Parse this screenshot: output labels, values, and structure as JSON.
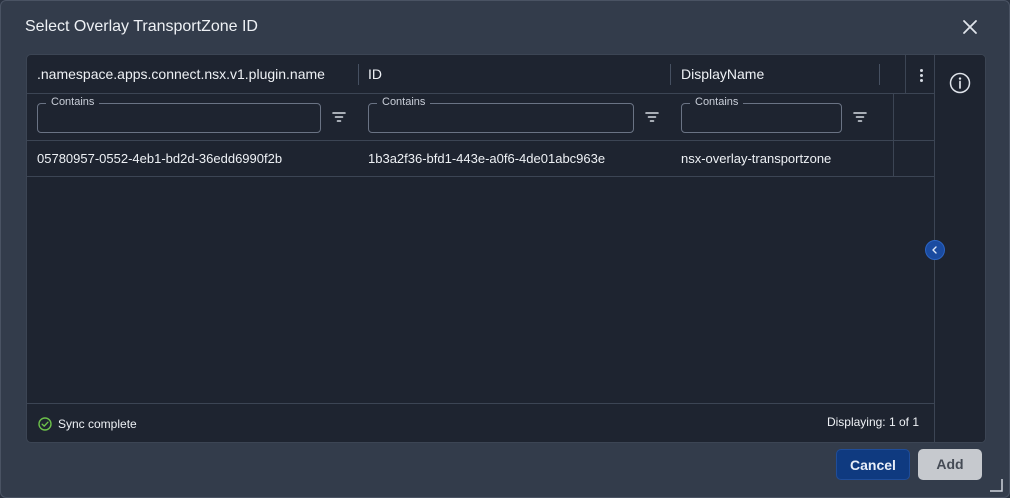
{
  "dialog": {
    "title": "Select Overlay TransportZone ID"
  },
  "grid": {
    "columns": [
      {
        "label": ".namespace.apps.connect.nsx.v1.plugin.name"
      },
      {
        "label": "ID"
      },
      {
        "label": "DisplayName"
      }
    ],
    "filters": [
      {
        "legend": "Contains",
        "value": ""
      },
      {
        "legend": "Contains",
        "value": ""
      },
      {
        "legend": "Contains",
        "value": ""
      }
    ],
    "rows": [
      {
        "name": "05780957-0552-4eb1-bd2d-36edd6990f2b",
        "id": "1b3a2f36-bfd1-443e-a0f6-4de01abc963e",
        "display_name": "nsx-overlay-transportzone"
      }
    ],
    "footer": {
      "status": "Sync complete",
      "count": "Displaying: 1 of 1"
    }
  },
  "actions": {
    "cancel": "Cancel",
    "add": "Add"
  },
  "icons": {
    "close": "close-icon",
    "column_menu": "kebab-menu-icon",
    "filter": "filter-icon",
    "info": "info-icon",
    "collapse": "chevron-left-icon",
    "sync": "check-circle-icon",
    "resize": "resize-grip-icon"
  },
  "colors": {
    "dialog_bg": "#333c4b",
    "panel_bg": "#1e2430",
    "primary_button": "#0f3a80",
    "disabled_button": "#c6c9ce",
    "success": "#6cc04a"
  }
}
